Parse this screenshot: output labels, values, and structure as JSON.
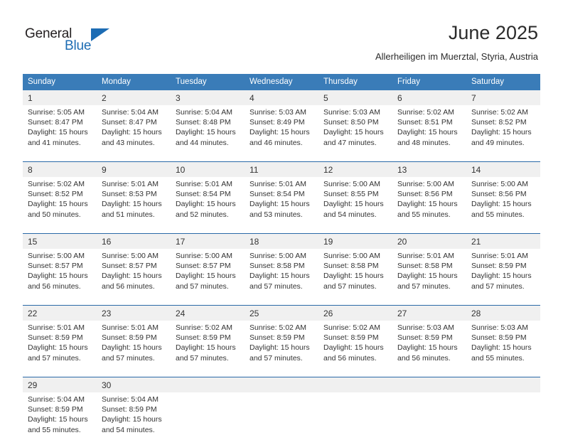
{
  "brand": {
    "name_top": "General",
    "name_bottom": "Blue",
    "triangle_color": "#1c6cb4",
    "text_color": "#231f20",
    "accent_color": "#1d6cb3"
  },
  "header": {
    "title": "June 2025",
    "subtitle": "Allerheiligen im Muerztal, Styria, Austria"
  },
  "theme": {
    "header_bg": "#3a7cb8",
    "daynum_bg": "#f0f0f0",
    "rule_color": "#2a69a8",
    "text_color": "#333333"
  },
  "weekdays": [
    "Sunday",
    "Monday",
    "Tuesday",
    "Wednesday",
    "Thursday",
    "Friday",
    "Saturday"
  ],
  "weeks": [
    [
      {
        "day": "1",
        "sunrise": "Sunrise: 5:05 AM",
        "sunset": "Sunset: 8:47 PM",
        "daylight1": "Daylight: 15 hours",
        "daylight2": "and 41 minutes."
      },
      {
        "day": "2",
        "sunrise": "Sunrise: 5:04 AM",
        "sunset": "Sunset: 8:47 PM",
        "daylight1": "Daylight: 15 hours",
        "daylight2": "and 43 minutes."
      },
      {
        "day": "3",
        "sunrise": "Sunrise: 5:04 AM",
        "sunset": "Sunset: 8:48 PM",
        "daylight1": "Daylight: 15 hours",
        "daylight2": "and 44 minutes."
      },
      {
        "day": "4",
        "sunrise": "Sunrise: 5:03 AM",
        "sunset": "Sunset: 8:49 PM",
        "daylight1": "Daylight: 15 hours",
        "daylight2": "and 46 minutes."
      },
      {
        "day": "5",
        "sunrise": "Sunrise: 5:03 AM",
        "sunset": "Sunset: 8:50 PM",
        "daylight1": "Daylight: 15 hours",
        "daylight2": "and 47 minutes."
      },
      {
        "day": "6",
        "sunrise": "Sunrise: 5:02 AM",
        "sunset": "Sunset: 8:51 PM",
        "daylight1": "Daylight: 15 hours",
        "daylight2": "and 48 minutes."
      },
      {
        "day": "7",
        "sunrise": "Sunrise: 5:02 AM",
        "sunset": "Sunset: 8:52 PM",
        "daylight1": "Daylight: 15 hours",
        "daylight2": "and 49 minutes."
      }
    ],
    [
      {
        "day": "8",
        "sunrise": "Sunrise: 5:02 AM",
        "sunset": "Sunset: 8:52 PM",
        "daylight1": "Daylight: 15 hours",
        "daylight2": "and 50 minutes."
      },
      {
        "day": "9",
        "sunrise": "Sunrise: 5:01 AM",
        "sunset": "Sunset: 8:53 PM",
        "daylight1": "Daylight: 15 hours",
        "daylight2": "and 51 minutes."
      },
      {
        "day": "10",
        "sunrise": "Sunrise: 5:01 AM",
        "sunset": "Sunset: 8:54 PM",
        "daylight1": "Daylight: 15 hours",
        "daylight2": "and 52 minutes."
      },
      {
        "day": "11",
        "sunrise": "Sunrise: 5:01 AM",
        "sunset": "Sunset: 8:54 PM",
        "daylight1": "Daylight: 15 hours",
        "daylight2": "and 53 minutes."
      },
      {
        "day": "12",
        "sunrise": "Sunrise: 5:00 AM",
        "sunset": "Sunset: 8:55 PM",
        "daylight1": "Daylight: 15 hours",
        "daylight2": "and 54 minutes."
      },
      {
        "day": "13",
        "sunrise": "Sunrise: 5:00 AM",
        "sunset": "Sunset: 8:56 PM",
        "daylight1": "Daylight: 15 hours",
        "daylight2": "and 55 minutes."
      },
      {
        "day": "14",
        "sunrise": "Sunrise: 5:00 AM",
        "sunset": "Sunset: 8:56 PM",
        "daylight1": "Daylight: 15 hours",
        "daylight2": "and 55 minutes."
      }
    ],
    [
      {
        "day": "15",
        "sunrise": "Sunrise: 5:00 AM",
        "sunset": "Sunset: 8:57 PM",
        "daylight1": "Daylight: 15 hours",
        "daylight2": "and 56 minutes."
      },
      {
        "day": "16",
        "sunrise": "Sunrise: 5:00 AM",
        "sunset": "Sunset: 8:57 PM",
        "daylight1": "Daylight: 15 hours",
        "daylight2": "and 56 minutes."
      },
      {
        "day": "17",
        "sunrise": "Sunrise: 5:00 AM",
        "sunset": "Sunset: 8:57 PM",
        "daylight1": "Daylight: 15 hours",
        "daylight2": "and 57 minutes."
      },
      {
        "day": "18",
        "sunrise": "Sunrise: 5:00 AM",
        "sunset": "Sunset: 8:58 PM",
        "daylight1": "Daylight: 15 hours",
        "daylight2": "and 57 minutes."
      },
      {
        "day": "19",
        "sunrise": "Sunrise: 5:00 AM",
        "sunset": "Sunset: 8:58 PM",
        "daylight1": "Daylight: 15 hours",
        "daylight2": "and 57 minutes."
      },
      {
        "day": "20",
        "sunrise": "Sunrise: 5:01 AM",
        "sunset": "Sunset: 8:58 PM",
        "daylight1": "Daylight: 15 hours",
        "daylight2": "and 57 minutes."
      },
      {
        "day": "21",
        "sunrise": "Sunrise: 5:01 AM",
        "sunset": "Sunset: 8:59 PM",
        "daylight1": "Daylight: 15 hours",
        "daylight2": "and 57 minutes."
      }
    ],
    [
      {
        "day": "22",
        "sunrise": "Sunrise: 5:01 AM",
        "sunset": "Sunset: 8:59 PM",
        "daylight1": "Daylight: 15 hours",
        "daylight2": "and 57 minutes."
      },
      {
        "day": "23",
        "sunrise": "Sunrise: 5:01 AM",
        "sunset": "Sunset: 8:59 PM",
        "daylight1": "Daylight: 15 hours",
        "daylight2": "and 57 minutes."
      },
      {
        "day": "24",
        "sunrise": "Sunrise: 5:02 AM",
        "sunset": "Sunset: 8:59 PM",
        "daylight1": "Daylight: 15 hours",
        "daylight2": "and 57 minutes."
      },
      {
        "day": "25",
        "sunrise": "Sunrise: 5:02 AM",
        "sunset": "Sunset: 8:59 PM",
        "daylight1": "Daylight: 15 hours",
        "daylight2": "and 57 minutes."
      },
      {
        "day": "26",
        "sunrise": "Sunrise: 5:02 AM",
        "sunset": "Sunset: 8:59 PM",
        "daylight1": "Daylight: 15 hours",
        "daylight2": "and 56 minutes."
      },
      {
        "day": "27",
        "sunrise": "Sunrise: 5:03 AM",
        "sunset": "Sunset: 8:59 PM",
        "daylight1": "Daylight: 15 hours",
        "daylight2": "and 56 minutes."
      },
      {
        "day": "28",
        "sunrise": "Sunrise: 5:03 AM",
        "sunset": "Sunset: 8:59 PM",
        "daylight1": "Daylight: 15 hours",
        "daylight2": "and 55 minutes."
      }
    ],
    [
      {
        "day": "29",
        "sunrise": "Sunrise: 5:04 AM",
        "sunset": "Sunset: 8:59 PM",
        "daylight1": "Daylight: 15 hours",
        "daylight2": "and 55 minutes."
      },
      {
        "day": "30",
        "sunrise": "Sunrise: 5:04 AM",
        "sunset": "Sunset: 8:59 PM",
        "daylight1": "Daylight: 15 hours",
        "daylight2": "and 54 minutes."
      },
      {
        "day": "",
        "sunrise": "",
        "sunset": "",
        "daylight1": "",
        "daylight2": ""
      },
      {
        "day": "",
        "sunrise": "",
        "sunset": "",
        "daylight1": "",
        "daylight2": ""
      },
      {
        "day": "",
        "sunrise": "",
        "sunset": "",
        "daylight1": "",
        "daylight2": ""
      },
      {
        "day": "",
        "sunrise": "",
        "sunset": "",
        "daylight1": "",
        "daylight2": ""
      },
      {
        "day": "",
        "sunrise": "",
        "sunset": "",
        "daylight1": "",
        "daylight2": ""
      }
    ]
  ]
}
